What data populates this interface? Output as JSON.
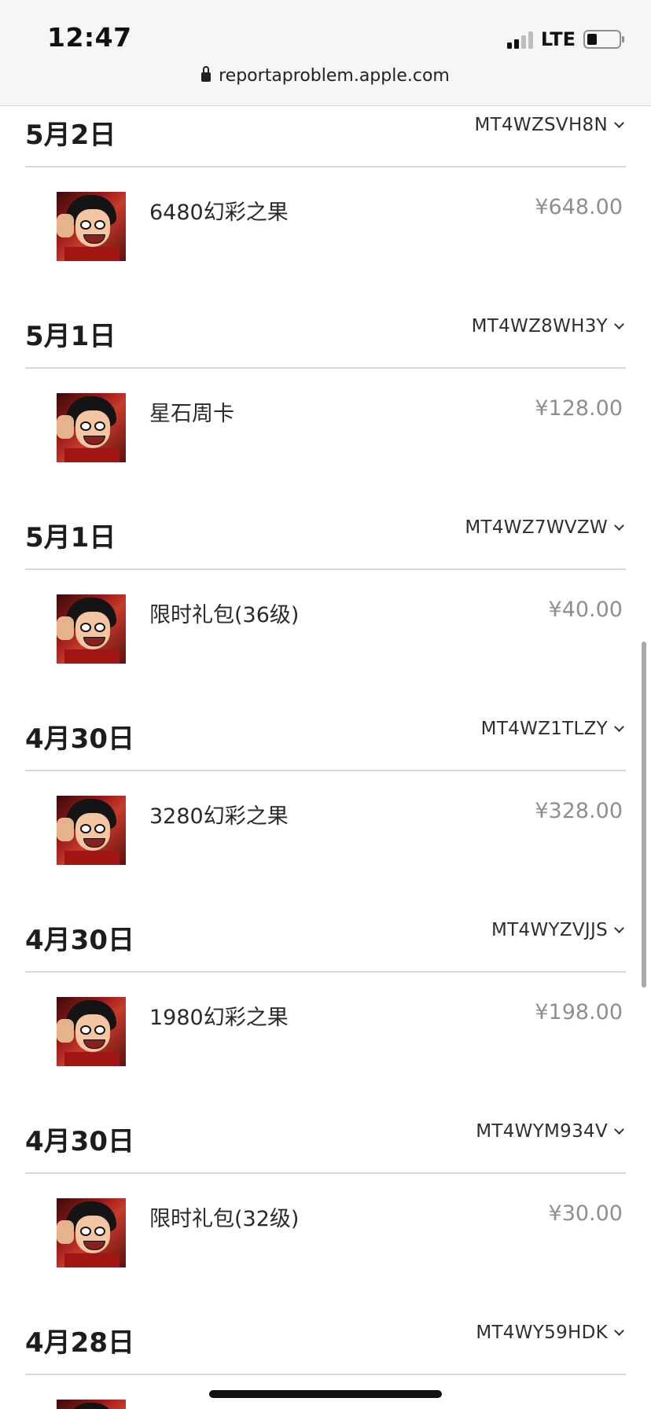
{
  "status_bar": {
    "time": "12:47",
    "network": "LTE",
    "icons": [
      "signal-icon",
      "battery-icon"
    ]
  },
  "browser": {
    "url": "reportaproblem.apple.com",
    "icon": "lock-icon"
  },
  "orders": [
    {
      "date": "5月2日",
      "order_id": "MT4WZSVH8N",
      "item": "6480幻彩之果",
      "price": "¥648.00"
    },
    {
      "date": "5月1日",
      "order_id": "MT4WZ8WH3Y",
      "item": "星石周卡",
      "price": "¥128.00"
    },
    {
      "date": "5月1日",
      "order_id": "MT4WZ7WVZW",
      "item": "限时礼包(36级)",
      "price": "¥40.00"
    },
    {
      "date": "4月30日",
      "order_id": "MT4WZ1TLZY",
      "item": "3280幻彩之果",
      "price": "¥328.00"
    },
    {
      "date": "4月30日",
      "order_id": "MT4WYZVJJS",
      "item": "1980幻彩之果",
      "price": "¥198.00"
    },
    {
      "date": "4月30日",
      "order_id": "MT4WYM934V",
      "item": "限时礼包(32级)",
      "price": "¥30.00"
    },
    {
      "date": "4月28日",
      "order_id": "MT4WY59HDK",
      "item": "",
      "price": ""
    }
  ],
  "colors": {
    "price_gray": "#8e8e93",
    "divider": "#d9d9d9",
    "chrome_bg": "#f6f6f6"
  }
}
